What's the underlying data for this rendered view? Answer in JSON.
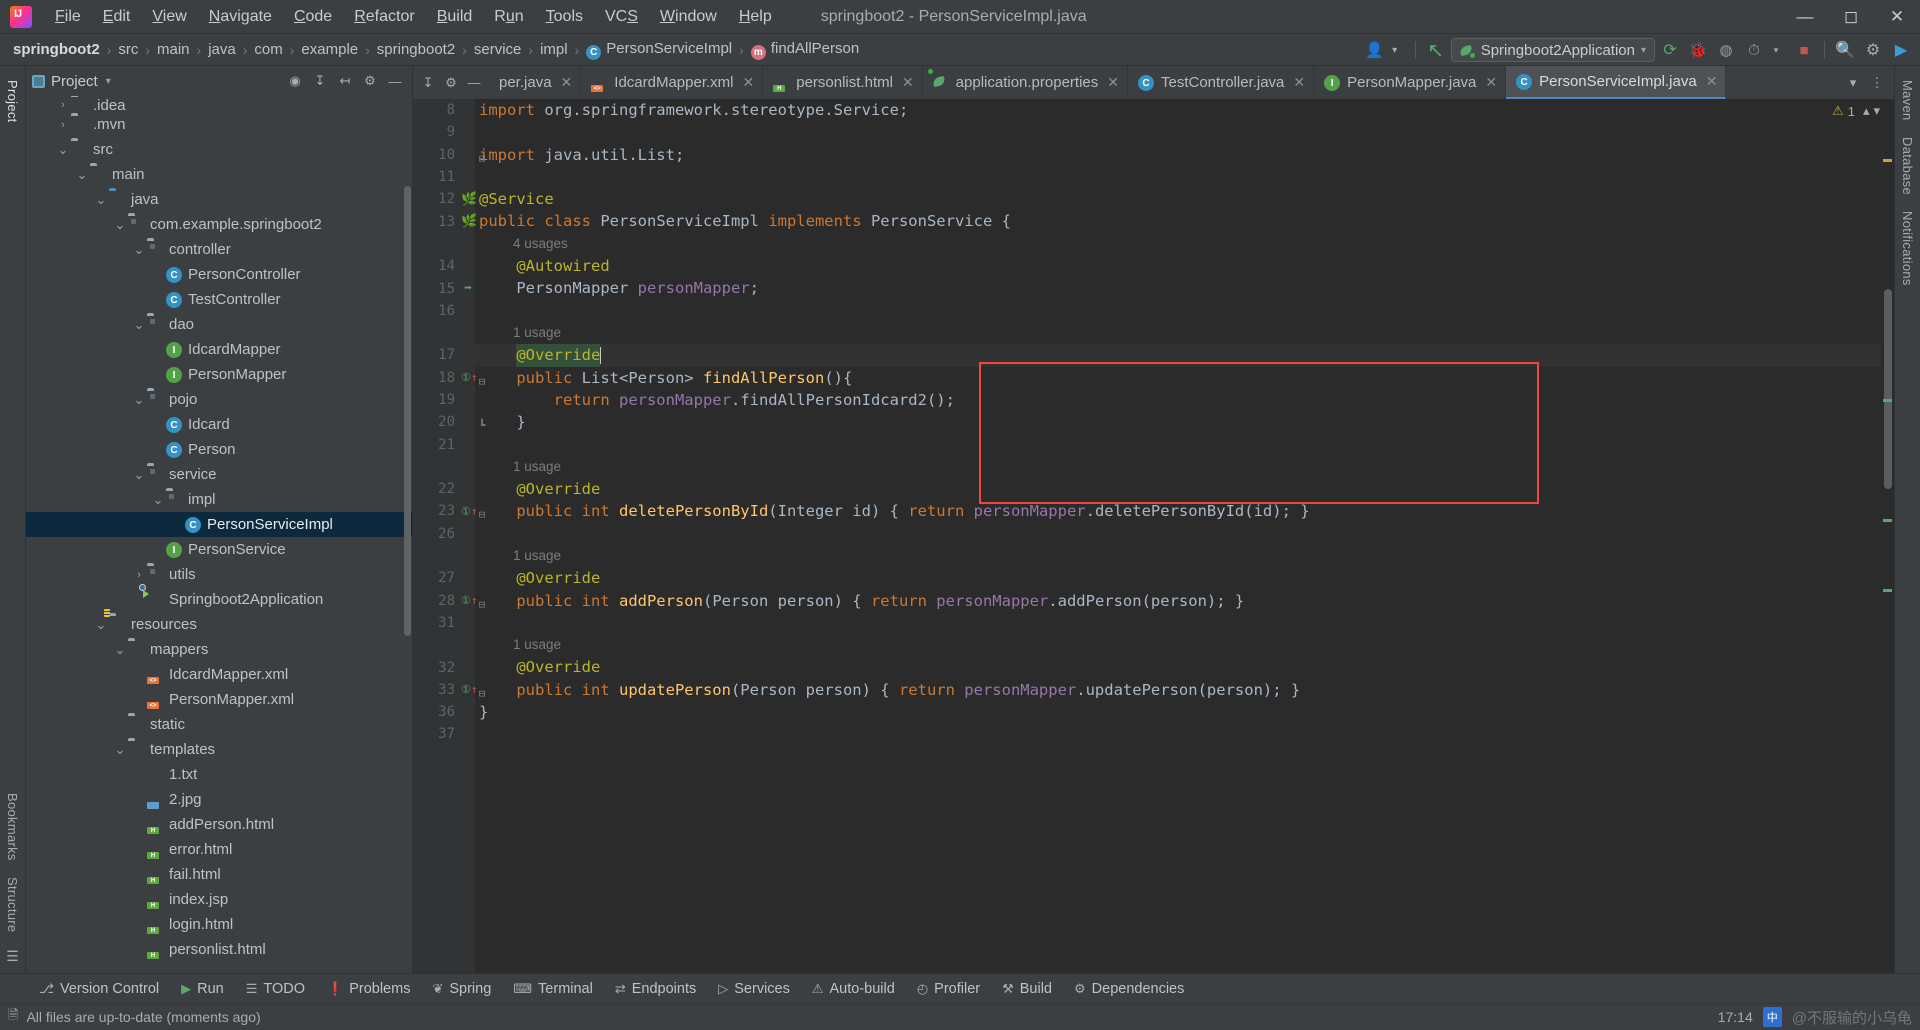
{
  "window": {
    "title": "springboot2 - PersonServiceImpl.java",
    "logo_icon": "intellij-idea-logo",
    "minimize_icon": "minimize-icon",
    "maximize_icon": "maximize-icon",
    "close_icon": "close-icon"
  },
  "menu": [
    {
      "label": "File",
      "mnemonic": "F"
    },
    {
      "label": "Edit",
      "mnemonic": "E"
    },
    {
      "label": "View",
      "mnemonic": "V"
    },
    {
      "label": "Navigate",
      "mnemonic": "N"
    },
    {
      "label": "Code",
      "mnemonic": "C"
    },
    {
      "label": "Refactor",
      "mnemonic": "R"
    },
    {
      "label": "Build",
      "mnemonic": "B"
    },
    {
      "label": "Run",
      "mnemonic": "u"
    },
    {
      "label": "Tools",
      "mnemonic": "T"
    },
    {
      "label": "VCS",
      "mnemonic": "S"
    },
    {
      "label": "Window",
      "mnemonic": "W"
    },
    {
      "label": "Help",
      "mnemonic": "H"
    }
  ],
  "breadcrumbs": [
    {
      "label": "springboot2",
      "icon": "",
      "bold": true
    },
    {
      "label": "src",
      "icon": ""
    },
    {
      "label": "main",
      "icon": ""
    },
    {
      "label": "java",
      "icon": ""
    },
    {
      "label": "com",
      "icon": ""
    },
    {
      "label": "example",
      "icon": ""
    },
    {
      "label": "springboot2",
      "icon": ""
    },
    {
      "label": "service",
      "icon": ""
    },
    {
      "label": "impl",
      "icon": ""
    },
    {
      "label": "PersonServiceImpl",
      "icon": "class-icon",
      "icon_letter": "C",
      "icon_kind": "class"
    },
    {
      "label": "findAllPerson",
      "icon": "method-icon",
      "icon_letter": "m",
      "icon_kind": "method"
    }
  ],
  "toolbar": {
    "run_configuration": "Springboot2Application",
    "run_config_icon": "spring-leaf-icon",
    "dropdown_icon": "chevron-down-icon",
    "icons": [
      {
        "name": "user-account-icon",
        "glyph": "👤"
      },
      {
        "name": "updates-arrow-icon",
        "glyph": "↖"
      },
      {
        "name": "run-icon",
        "glyph": "⟳"
      },
      {
        "name": "debug-icon",
        "glyph": "🐞"
      },
      {
        "name": "run-with-coverage-icon",
        "glyph": "▶"
      },
      {
        "name": "profiler-icon",
        "glyph": "◴"
      },
      {
        "name": "stop-icon",
        "glyph": "■"
      },
      {
        "name": "search-everywhere-icon",
        "glyph": "🔍"
      },
      {
        "name": "settings-gear-icon",
        "glyph": "⚙"
      },
      {
        "name": "ide-assistant-icon",
        "glyph": "▶"
      }
    ]
  },
  "left_strip": [
    {
      "label": "Project",
      "name": "tool-window-project",
      "active": true
    },
    {
      "label": "Bookmarks",
      "name": "tool-window-bookmarks",
      "active": false
    },
    {
      "label": "Structure",
      "name": "tool-window-structure",
      "active": false
    }
  ],
  "right_strip": [
    {
      "label": "Maven",
      "name": "tool-window-maven"
    },
    {
      "label": "Database",
      "name": "tool-window-database"
    },
    {
      "label": "Notifications",
      "name": "tool-window-notifications"
    }
  ],
  "project_panel": {
    "title": "Project",
    "dropdown_icon": "chevron-down-icon",
    "header_icons": [
      {
        "name": "select-opened-file-icon",
        "glyph": "⊕"
      },
      {
        "name": "collapse-all-icon",
        "glyph": "↧"
      },
      {
        "name": "expand-all-icon",
        "glyph": "↥"
      },
      {
        "name": "settings-gear-icon",
        "glyph": "⚙"
      },
      {
        "name": "hide-icon",
        "glyph": "—"
      }
    ],
    "tree": [
      {
        "label": ".idea",
        "indent": 1,
        "arrow": "›",
        "icon": "folder",
        "partial": true
      },
      {
        "label": ".mvn",
        "indent": 1,
        "arrow": "›",
        "icon": "folder"
      },
      {
        "label": "src",
        "indent": 1,
        "arrow": "⌄",
        "icon": "folder"
      },
      {
        "label": "main",
        "indent": 2,
        "arrow": "⌄",
        "icon": "folder"
      },
      {
        "label": "java",
        "indent": 3,
        "arrow": "⌄",
        "icon": "folder-blue"
      },
      {
        "label": "com.example.springboot2",
        "indent": 4,
        "arrow": "⌄",
        "icon": "folder-pkg"
      },
      {
        "label": "controller",
        "indent": 5,
        "arrow": "⌄",
        "icon": "folder-pkg"
      },
      {
        "label": "PersonController",
        "indent": 6,
        "arrow": "",
        "icon": "class"
      },
      {
        "label": "TestController",
        "indent": 6,
        "arrow": "",
        "icon": "class"
      },
      {
        "label": "dao",
        "indent": 5,
        "arrow": "⌄",
        "icon": "folder-pkg"
      },
      {
        "label": "IdcardMapper",
        "indent": 6,
        "arrow": "",
        "icon": "interface"
      },
      {
        "label": "PersonMapper",
        "indent": 6,
        "arrow": "",
        "icon": "interface"
      },
      {
        "label": "pojo",
        "indent": 5,
        "arrow": "⌄",
        "icon": "folder-pkg"
      },
      {
        "label": "Idcard",
        "indent": 6,
        "arrow": "",
        "icon": "class"
      },
      {
        "label": "Person",
        "indent": 6,
        "arrow": "",
        "icon": "class"
      },
      {
        "label": "service",
        "indent": 5,
        "arrow": "⌄",
        "icon": "folder-pkg"
      },
      {
        "label": "impl",
        "indent": 6,
        "arrow": "⌄",
        "icon": "folder-pkg"
      },
      {
        "label": "PersonServiceImpl",
        "indent": 7,
        "arrow": "",
        "icon": "class",
        "selected": true
      },
      {
        "label": "PersonService",
        "indent": 6,
        "arrow": "",
        "icon": "interface"
      },
      {
        "label": "utils",
        "indent": 5,
        "arrow": "›",
        "icon": "folder-pkg"
      },
      {
        "label": "Springboot2Application",
        "indent": 5,
        "arrow": "",
        "icon": "spring"
      },
      {
        "label": "resources",
        "indent": 3,
        "arrow": "⌄",
        "icon": "folder-res"
      },
      {
        "label": "mappers",
        "indent": 4,
        "arrow": "⌄",
        "icon": "folder"
      },
      {
        "label": "IdcardMapper.xml",
        "indent": 5,
        "arrow": "",
        "icon": "file-xml"
      },
      {
        "label": "PersonMapper.xml",
        "indent": 5,
        "arrow": "",
        "icon": "file-xml"
      },
      {
        "label": "static",
        "indent": 4,
        "arrow": "",
        "icon": "folder"
      },
      {
        "label": "templates",
        "indent": 4,
        "arrow": "⌄",
        "icon": "folder"
      },
      {
        "label": "1.txt",
        "indent": 5,
        "arrow": "",
        "icon": "file-txt"
      },
      {
        "label": "2.jpg",
        "indent": 5,
        "arrow": "",
        "icon": "file-jpg"
      },
      {
        "label": "addPerson.html",
        "indent": 5,
        "arrow": "",
        "icon": "file-html"
      },
      {
        "label": "error.html",
        "indent": 5,
        "arrow": "",
        "icon": "file-html"
      },
      {
        "label": "fail.html",
        "indent": 5,
        "arrow": "",
        "icon": "file-html"
      },
      {
        "label": "index.jsp",
        "indent": 5,
        "arrow": "",
        "icon": "file-html"
      },
      {
        "label": "login.html",
        "indent": 5,
        "arrow": "",
        "icon": "file-html"
      },
      {
        "label": "personlist.html",
        "indent": 5,
        "arrow": "",
        "icon": "file-html"
      }
    ]
  },
  "editor_tabs": [
    {
      "label": "per.java",
      "icon": "class-icon",
      "active": false,
      "truncated": true
    },
    {
      "label": "IdcardMapper.xml",
      "icon": "xml-file-icon",
      "active": false
    },
    {
      "label": "personlist.html",
      "icon": "html-file-icon",
      "active": false
    },
    {
      "label": "application.properties",
      "icon": "spring-properties-icon",
      "active": false
    },
    {
      "label": "TestController.java",
      "icon": "class-icon",
      "active": false
    },
    {
      "label": "PersonMapper.java",
      "icon": "interface-icon",
      "active": false
    },
    {
      "label": "PersonServiceImpl.java",
      "icon": "class-icon",
      "active": true
    }
  ],
  "tab_actions": [
    {
      "name": "tab-list-dropdown",
      "glyph": "⌄"
    },
    {
      "name": "tab-options-menu",
      "glyph": "⋮"
    }
  ],
  "editor": {
    "inspection_count": "1",
    "inspection_icon": "warning-triangle-icon",
    "lines": [
      {
        "num": "8",
        "kind": "code",
        "tokens": [
          {
            "t": "import ",
            "c": "kw"
          },
          {
            "t": "org.springframework.stereotype.",
            "c": "pln"
          },
          {
            "t": "Service",
            "c": "typ"
          },
          {
            "t": ";",
            "c": "pln"
          }
        ],
        "indent": 0
      },
      {
        "num": "9",
        "kind": "code",
        "tokens": [],
        "indent": 0
      },
      {
        "num": "10",
        "kind": "code",
        "fold": true,
        "tokens": [
          {
            "t": "import ",
            "c": "kw"
          },
          {
            "t": "java.util.List;",
            "c": "pln"
          }
        ],
        "indent": 0
      },
      {
        "num": "11",
        "kind": "code",
        "tokens": [],
        "indent": 0
      },
      {
        "num": "12",
        "kind": "code",
        "gutter_icon": "spring-bean-icon",
        "tokens": [
          {
            "t": "@Service",
            "c": "ann"
          }
        ],
        "indent": 0
      },
      {
        "num": "13",
        "kind": "code",
        "gutter_icon": "spring-implemented-icon",
        "tokens": [
          {
            "t": "public class ",
            "c": "kw"
          },
          {
            "t": "PersonServiceImpl ",
            "c": "pln"
          },
          {
            "t": "implements ",
            "c": "kw"
          },
          {
            "t": "PersonService",
            "c": "pln"
          },
          {
            "t": " {",
            "c": "pln"
          }
        ],
        "indent": 0
      },
      {
        "num": "",
        "kind": "hint",
        "text": "4 usages"
      },
      {
        "num": "14",
        "kind": "code",
        "tokens": [
          {
            "t": "@Autowired",
            "c": "ann"
          }
        ],
        "indent": 1
      },
      {
        "num": "15",
        "kind": "code",
        "gutter_icon": "autowired-arrow-icon",
        "tokens": [
          {
            "t": "PersonMapper ",
            "c": "pln"
          },
          {
            "t": "personMapper",
            "c": "fld"
          },
          {
            "t": ";",
            "c": "pln"
          }
        ],
        "indent": 1
      },
      {
        "num": "16",
        "kind": "code",
        "tokens": [],
        "indent": 0
      },
      {
        "num": "",
        "kind": "hint",
        "text": "1 usage"
      },
      {
        "num": "17",
        "kind": "code",
        "current": true,
        "selection": "@Override",
        "tokens": [
          {
            "t": "@Override",
            "c": "ann sel-green"
          }
        ],
        "indent": 1
      },
      {
        "num": "18",
        "kind": "code",
        "gutter_icon": "override-method-icon",
        "fold": true,
        "tokens": [
          {
            "t": "public ",
            "c": "kw"
          },
          {
            "t": "List",
            "c": "typ"
          },
          {
            "t": "<Person> ",
            "c": "pln"
          },
          {
            "t": "findAllPerson",
            "c": "mth"
          },
          {
            "t": "(){",
            "c": "pln"
          }
        ],
        "indent": 1
      },
      {
        "num": "19",
        "kind": "code",
        "tokens": [
          {
            "t": "return ",
            "c": "kw"
          },
          {
            "t": "personMapper",
            "c": "fld"
          },
          {
            "t": ".",
            "c": "pln"
          },
          {
            "t": "findAllPersonIdcard2",
            "c": "pln"
          },
          {
            "t": "();",
            "c": "pln"
          }
        ],
        "indent": 2
      },
      {
        "num": "20",
        "kind": "code",
        "fold_end": true,
        "tokens": [
          {
            "t": "}",
            "c": "pln"
          }
        ],
        "indent": 1
      },
      {
        "num": "21",
        "kind": "code",
        "tokens": [],
        "indent": 0
      },
      {
        "num": "",
        "kind": "hint",
        "text": "1 usage"
      },
      {
        "num": "22",
        "kind": "code",
        "tokens": [
          {
            "t": "@Override",
            "c": "ann"
          }
        ],
        "indent": 1
      },
      {
        "num": "23",
        "kind": "code",
        "gutter_icon": "override-method-icon",
        "fold": true,
        "tokens": [
          {
            "t": "public int ",
            "c": "kw"
          },
          {
            "t": "deletePersonById",
            "c": "mth"
          },
          {
            "t": "(Integer id) ",
            "c": "pln"
          },
          {
            "t": "{ ",
            "c": "pln"
          },
          {
            "t": "return ",
            "c": "kw"
          },
          {
            "t": "personMapper",
            "c": "fld"
          },
          {
            "t": ".deletePersonById(id); }",
            "c": "pln"
          }
        ],
        "indent": 1
      },
      {
        "num": "26",
        "kind": "code",
        "tokens": [],
        "indent": 0
      },
      {
        "num": "",
        "kind": "hint",
        "text": "1 usage"
      },
      {
        "num": "27",
        "kind": "code",
        "tokens": [
          {
            "t": "@Override",
            "c": "ann"
          }
        ],
        "indent": 1
      },
      {
        "num": "28",
        "kind": "code",
        "gutter_icon": "override-method-icon",
        "fold": true,
        "tokens": [
          {
            "t": "public int ",
            "c": "kw"
          },
          {
            "t": "addPerson",
            "c": "mth"
          },
          {
            "t": "(Person person) ",
            "c": "pln"
          },
          {
            "t": "{ ",
            "c": "pln"
          },
          {
            "t": "return ",
            "c": "kw"
          },
          {
            "t": "personMapper",
            "c": "fld"
          },
          {
            "t": ".addPerson(person); }",
            "c": "pln"
          }
        ],
        "indent": 1
      },
      {
        "num": "31",
        "kind": "code",
        "tokens": [],
        "indent": 0
      },
      {
        "num": "",
        "kind": "hint",
        "text": "1 usage"
      },
      {
        "num": "32",
        "kind": "code",
        "tokens": [
          {
            "t": "@Override",
            "c": "ann"
          }
        ],
        "indent": 1
      },
      {
        "num": "33",
        "kind": "code",
        "gutter_icon": "override-method-icon",
        "fold": true,
        "tokens": [
          {
            "t": "public int ",
            "c": "kw"
          },
          {
            "t": "updatePerson",
            "c": "mth"
          },
          {
            "t": "(Person person) ",
            "c": "pln"
          },
          {
            "t": "{ ",
            "c": "pln"
          },
          {
            "t": "return ",
            "c": "kw"
          },
          {
            "t": "personMapper",
            "c": "fld"
          },
          {
            "t": ".updatePerson(person); }",
            "c": "pln"
          }
        ],
        "indent": 1
      },
      {
        "num": "36",
        "kind": "code",
        "tokens": [
          {
            "t": "}",
            "c": "pln"
          }
        ],
        "indent": 0
      },
      {
        "num": "37",
        "kind": "code",
        "tokens": [],
        "indent": 0
      }
    ]
  },
  "bottom_tools": [
    {
      "label": "Version Control",
      "icon": "branch-icon"
    },
    {
      "label": "Run",
      "icon": "run-triangle-icon"
    },
    {
      "label": "TODO",
      "icon": "list-icon"
    },
    {
      "label": "Problems",
      "icon": "error-circle-icon"
    },
    {
      "label": "Spring",
      "icon": "spring-leaf-icon"
    },
    {
      "label": "Terminal",
      "icon": "terminal-icon"
    },
    {
      "label": "Endpoints",
      "icon": "endpoints-icon"
    },
    {
      "label": "Services",
      "icon": "services-icon"
    },
    {
      "label": "Auto-build",
      "icon": "build-triangle-icon"
    },
    {
      "label": "Profiler",
      "icon": "profiler-clock-icon"
    },
    {
      "label": "Build",
      "icon": "hammer-icon"
    },
    {
      "label": "Dependencies",
      "icon": "dependencies-icon"
    }
  ],
  "status": {
    "message": "All files are up-to-date (moments ago)",
    "message_icon": "save-state-icon",
    "time": "17:14",
    "ime_label": "中",
    "watermark": "@不服输的小乌龟"
  }
}
